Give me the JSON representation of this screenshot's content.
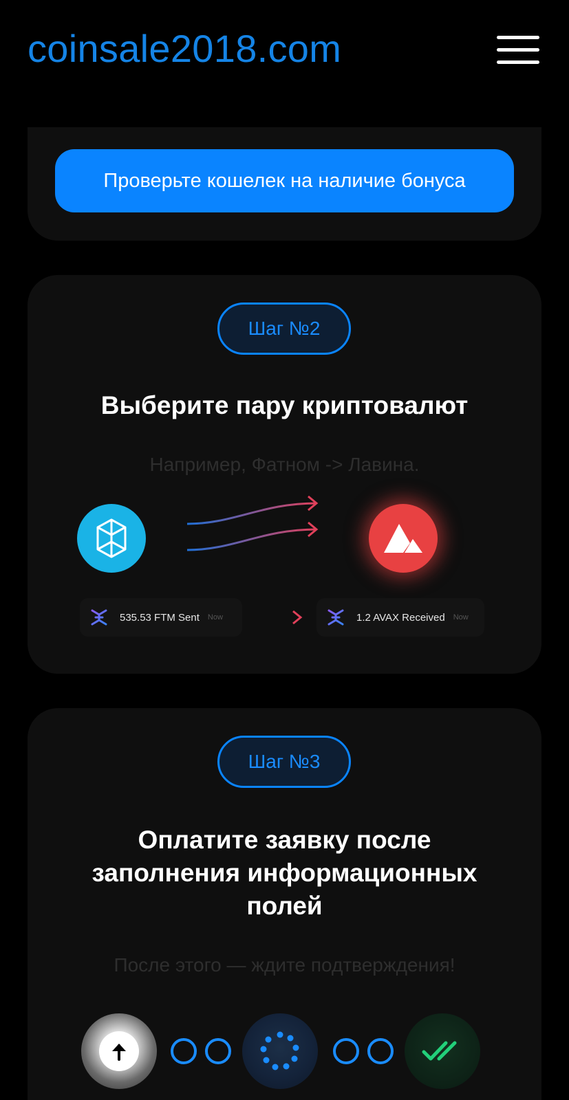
{
  "header": {
    "logo_text": "coinsale2018.com",
    "menu_icon": "hamburger-menu-icon"
  },
  "step1": {
    "button_label": "Проверьте кошелек на наличие бонуса"
  },
  "step2": {
    "pill_label": "Шаг №2",
    "title": "Выберите пару криптовалют",
    "subtitle": "Например, Фатном -> Лавина.",
    "from_coin_icon": "fantom-coin-icon",
    "to_coin_icon": "avalanche-coin-icon",
    "sent_tx": {
      "text": "535.53 FTM Sent",
      "time": "Now"
    },
    "received_tx": {
      "text": "1.2 AVAX Received",
      "time": "Now"
    },
    "colors": {
      "fantom": "#1ab3e6",
      "avalanche": "#e84142",
      "accent": "#0a84ff"
    }
  },
  "step3": {
    "pill_label": "Шаг №3",
    "title_lines": [
      "Оплатите заявку после",
      "заполнения информационных",
      "полей"
    ],
    "subtitle": "После этого — ждите подтверждения!",
    "status_icons": [
      "upload-arrow-icon",
      "loading-spinner-icon",
      "double-check-icon"
    ]
  }
}
